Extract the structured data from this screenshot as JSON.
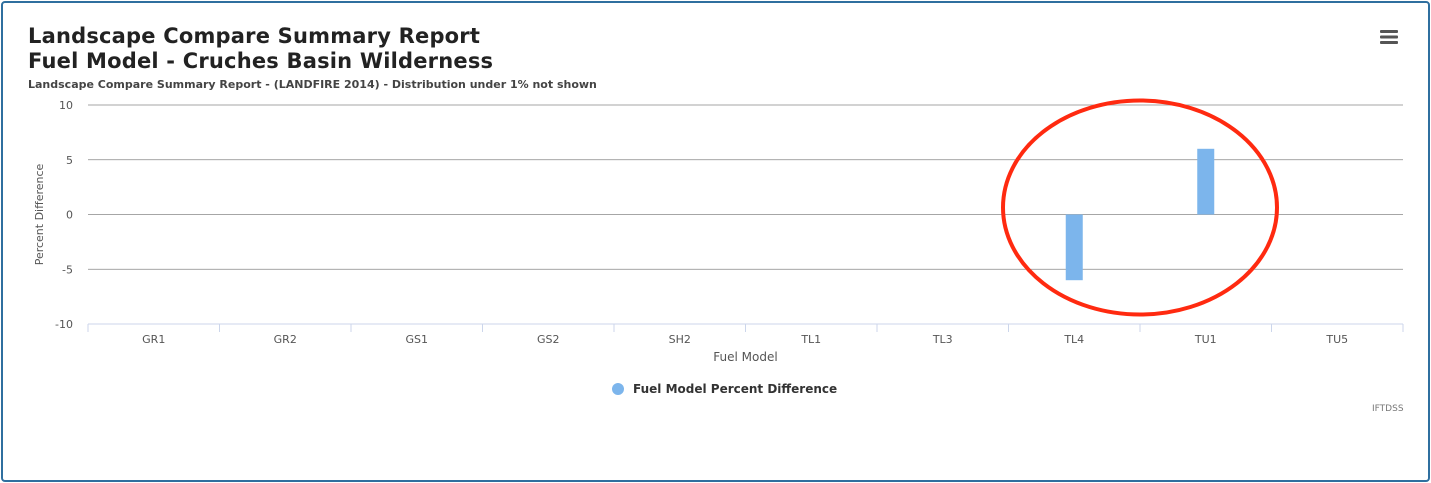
{
  "title_line1": "Landscape Compare Summary Report",
  "title_line2": "Fuel Model - Cruches Basin Wilderness",
  "subtitle": "Landscape Compare Summary Report - (LANDFIRE 2014) - Distribution under 1% not shown",
  "credit": "IFTDSS",
  "menu_icon": "hamburger-menu-icon",
  "colors": {
    "bar": "#7cb5ec",
    "annotation": "#ff2a10",
    "grid": "#888888",
    "frame": "#2f6f9f"
  },
  "chart_data": {
    "type": "bar",
    "categories": [
      "GR1",
      "GR2",
      "GS1",
      "GS2",
      "SH2",
      "TL1",
      "TL3",
      "TL4",
      "TU1",
      "TU5"
    ],
    "series": [
      {
        "name": "Fuel Model Percent Difference",
        "values": [
          0,
          0,
          0,
          0,
          0,
          0,
          0,
          -6,
          6,
          0
        ]
      }
    ],
    "xlabel": "Fuel Model",
    "ylabel": "Percent Difference",
    "ylim": [
      -10,
      10
    ],
    "yticks": [
      10,
      5,
      0,
      -5,
      -10
    ],
    "grid": true,
    "legend": "bottom-center",
    "annotation": {
      "type": "red-ellipse",
      "highlights": [
        "TL4",
        "TU1"
      ]
    }
  }
}
